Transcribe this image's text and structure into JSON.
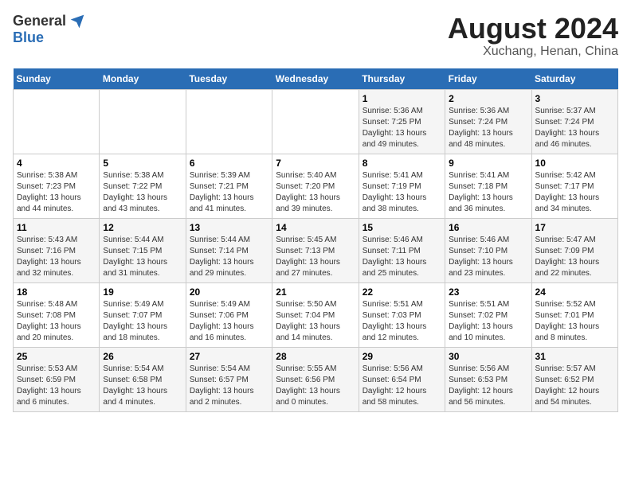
{
  "logo": {
    "general": "General",
    "blue": "Blue"
  },
  "title": "August 2024",
  "subtitle": "Xuchang, Henan, China",
  "days_of_week": [
    "Sunday",
    "Monday",
    "Tuesday",
    "Wednesday",
    "Thursday",
    "Friday",
    "Saturday"
  ],
  "weeks": [
    [
      {
        "num": "",
        "detail": ""
      },
      {
        "num": "",
        "detail": ""
      },
      {
        "num": "",
        "detail": ""
      },
      {
        "num": "",
        "detail": ""
      },
      {
        "num": "1",
        "detail": "Sunrise: 5:36 AM\nSunset: 7:25 PM\nDaylight: 13 hours\nand 49 minutes."
      },
      {
        "num": "2",
        "detail": "Sunrise: 5:36 AM\nSunset: 7:24 PM\nDaylight: 13 hours\nand 48 minutes."
      },
      {
        "num": "3",
        "detail": "Sunrise: 5:37 AM\nSunset: 7:24 PM\nDaylight: 13 hours\nand 46 minutes."
      }
    ],
    [
      {
        "num": "4",
        "detail": "Sunrise: 5:38 AM\nSunset: 7:23 PM\nDaylight: 13 hours\nand 44 minutes."
      },
      {
        "num": "5",
        "detail": "Sunrise: 5:38 AM\nSunset: 7:22 PM\nDaylight: 13 hours\nand 43 minutes."
      },
      {
        "num": "6",
        "detail": "Sunrise: 5:39 AM\nSunset: 7:21 PM\nDaylight: 13 hours\nand 41 minutes."
      },
      {
        "num": "7",
        "detail": "Sunrise: 5:40 AM\nSunset: 7:20 PM\nDaylight: 13 hours\nand 39 minutes."
      },
      {
        "num": "8",
        "detail": "Sunrise: 5:41 AM\nSunset: 7:19 PM\nDaylight: 13 hours\nand 38 minutes."
      },
      {
        "num": "9",
        "detail": "Sunrise: 5:41 AM\nSunset: 7:18 PM\nDaylight: 13 hours\nand 36 minutes."
      },
      {
        "num": "10",
        "detail": "Sunrise: 5:42 AM\nSunset: 7:17 PM\nDaylight: 13 hours\nand 34 minutes."
      }
    ],
    [
      {
        "num": "11",
        "detail": "Sunrise: 5:43 AM\nSunset: 7:16 PM\nDaylight: 13 hours\nand 32 minutes."
      },
      {
        "num": "12",
        "detail": "Sunrise: 5:44 AM\nSunset: 7:15 PM\nDaylight: 13 hours\nand 31 minutes."
      },
      {
        "num": "13",
        "detail": "Sunrise: 5:44 AM\nSunset: 7:14 PM\nDaylight: 13 hours\nand 29 minutes."
      },
      {
        "num": "14",
        "detail": "Sunrise: 5:45 AM\nSunset: 7:13 PM\nDaylight: 13 hours\nand 27 minutes."
      },
      {
        "num": "15",
        "detail": "Sunrise: 5:46 AM\nSunset: 7:11 PM\nDaylight: 13 hours\nand 25 minutes."
      },
      {
        "num": "16",
        "detail": "Sunrise: 5:46 AM\nSunset: 7:10 PM\nDaylight: 13 hours\nand 23 minutes."
      },
      {
        "num": "17",
        "detail": "Sunrise: 5:47 AM\nSunset: 7:09 PM\nDaylight: 13 hours\nand 22 minutes."
      }
    ],
    [
      {
        "num": "18",
        "detail": "Sunrise: 5:48 AM\nSunset: 7:08 PM\nDaylight: 13 hours\nand 20 minutes."
      },
      {
        "num": "19",
        "detail": "Sunrise: 5:49 AM\nSunset: 7:07 PM\nDaylight: 13 hours\nand 18 minutes."
      },
      {
        "num": "20",
        "detail": "Sunrise: 5:49 AM\nSunset: 7:06 PM\nDaylight: 13 hours\nand 16 minutes."
      },
      {
        "num": "21",
        "detail": "Sunrise: 5:50 AM\nSunset: 7:04 PM\nDaylight: 13 hours\nand 14 minutes."
      },
      {
        "num": "22",
        "detail": "Sunrise: 5:51 AM\nSunset: 7:03 PM\nDaylight: 13 hours\nand 12 minutes."
      },
      {
        "num": "23",
        "detail": "Sunrise: 5:51 AM\nSunset: 7:02 PM\nDaylight: 13 hours\nand 10 minutes."
      },
      {
        "num": "24",
        "detail": "Sunrise: 5:52 AM\nSunset: 7:01 PM\nDaylight: 13 hours\nand 8 minutes."
      }
    ],
    [
      {
        "num": "25",
        "detail": "Sunrise: 5:53 AM\nSunset: 6:59 PM\nDaylight: 13 hours\nand 6 minutes."
      },
      {
        "num": "26",
        "detail": "Sunrise: 5:54 AM\nSunset: 6:58 PM\nDaylight: 13 hours\nand 4 minutes."
      },
      {
        "num": "27",
        "detail": "Sunrise: 5:54 AM\nSunset: 6:57 PM\nDaylight: 13 hours\nand 2 minutes."
      },
      {
        "num": "28",
        "detail": "Sunrise: 5:55 AM\nSunset: 6:56 PM\nDaylight: 13 hours\nand 0 minutes."
      },
      {
        "num": "29",
        "detail": "Sunrise: 5:56 AM\nSunset: 6:54 PM\nDaylight: 12 hours\nand 58 minutes."
      },
      {
        "num": "30",
        "detail": "Sunrise: 5:56 AM\nSunset: 6:53 PM\nDaylight: 12 hours\nand 56 minutes."
      },
      {
        "num": "31",
        "detail": "Sunrise: 5:57 AM\nSunset: 6:52 PM\nDaylight: 12 hours\nand 54 minutes."
      }
    ]
  ]
}
